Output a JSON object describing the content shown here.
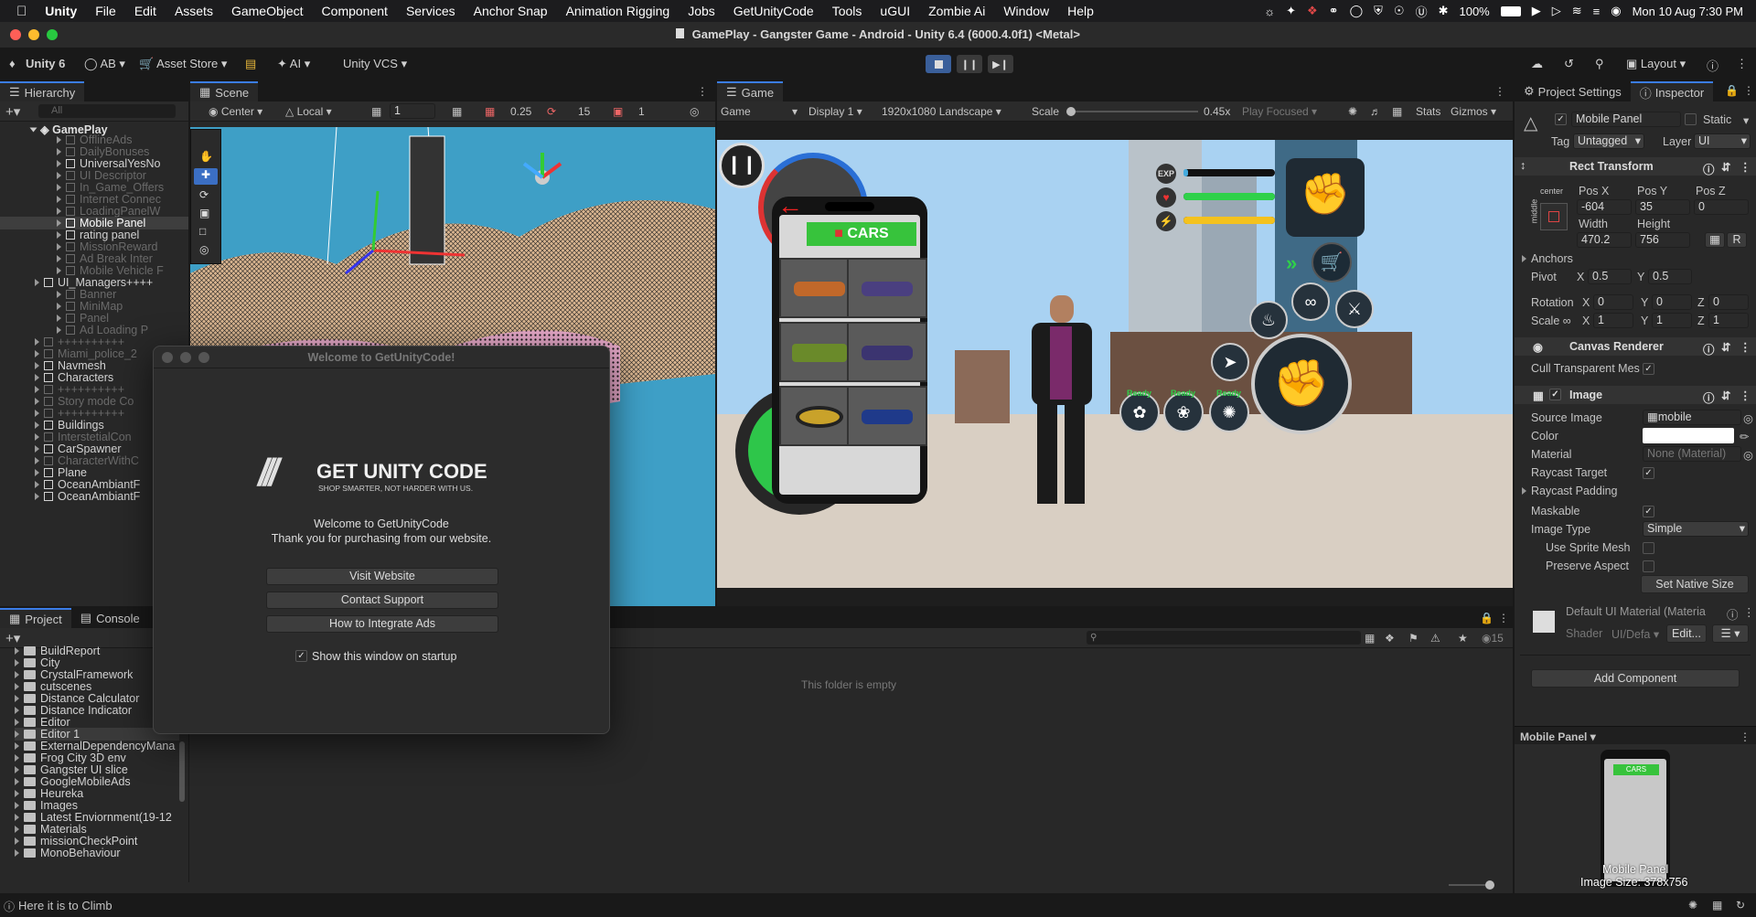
{
  "menubar": {
    "app": "Unity",
    "items": [
      "File",
      "Edit",
      "Assets",
      "GameObject",
      "Component",
      "Services",
      "Anchor Snap",
      "Animation Rigging",
      "Jobs",
      "GetUnityCode",
      "Tools",
      "uGUI",
      "Zombie Ai",
      "Window",
      "Help"
    ],
    "battery": "100%",
    "datetime": "Mon 10 Aug  7:30 PM"
  },
  "window": {
    "title": "GamePlay - Gangster Game - Android - Unity 6.4 (6000.4.0f1) <Metal>"
  },
  "toolbar": {
    "unity_label": "Unity 6",
    "account": "AB",
    "asset_store": "Asset Store",
    "ai": "AI",
    "vcs": "Unity VCS",
    "layout": "Layout"
  },
  "hierarchy": {
    "tab": "Hierarchy",
    "search_placeholder": "All",
    "root": "GamePlay",
    "items": [
      {
        "label": "OfflineAds",
        "dim": true
      },
      {
        "label": "DailyBonuses",
        "dim": true
      },
      {
        "label": "UniversalYesNo",
        "dim": false
      },
      {
        "label": "UI Descriptor",
        "dim": true
      },
      {
        "label": "In_Game_Offers",
        "dim": true
      },
      {
        "label": "Internet Connec",
        "dim": true
      },
      {
        "label": "LoadingPanelW",
        "dim": true
      },
      {
        "label": "Mobile Panel",
        "dim": false,
        "selected": true
      },
      {
        "label": "rating panel",
        "dim": false
      },
      {
        "label": "MissionReward",
        "dim": true
      },
      {
        "label": "Ad Break Inter",
        "dim": true
      },
      {
        "label": "Mobile Vehicle F",
        "dim": true
      },
      {
        "label": "UI_Managers++++",
        "dim": false
      },
      {
        "label": "Banner",
        "dim": true
      },
      {
        "label": "MiniMap",
        "dim": true
      },
      {
        "label": "Panel",
        "dim": true
      },
      {
        "label": "Ad Loading P",
        "dim": true
      },
      {
        "label": "++++++++++",
        "dim": true
      },
      {
        "label": "Miami_police_2",
        "dim": true
      },
      {
        "label": "Navmesh",
        "dim": false
      },
      {
        "label": "Characters",
        "dim": false
      },
      {
        "label": "++++++++++",
        "dim": true
      },
      {
        "label": "Story mode Co",
        "dim": true
      },
      {
        "label": "++++++++++",
        "dim": true
      },
      {
        "label": "Buildings",
        "dim": false
      },
      {
        "label": "InterstetialCon",
        "dim": true
      },
      {
        "label": "CarSpawner",
        "dim": false
      },
      {
        "label": "CharacterWithC",
        "dim": true
      },
      {
        "label": "Plane",
        "dim": false
      },
      {
        "label": "OceanAmbiantF",
        "dim": false
      },
      {
        "label": "OceanAmbiantF",
        "dim": false
      }
    ]
  },
  "scene": {
    "tab": "Scene",
    "pivot": "Center",
    "space": "Local",
    "grid": "1",
    "snap": "0.25",
    "angle": "15",
    "scale": "1"
  },
  "game": {
    "tab": "Game",
    "mode": "Game",
    "display": "Display 1",
    "resolution": "1920x1080 Landscape",
    "scale_label": "Scale",
    "scale_value": "0.45x",
    "play_focused": "Play Focused",
    "stats": "Stats",
    "gizmos": "Gizmos",
    "hud": {
      "exp": "EXP",
      "exp_fill": 0.05,
      "health_fill": 1.0,
      "energy_fill": 1.0,
      "ready": [
        "Ready",
        "Ready",
        "Ready"
      ]
    },
    "phone": {
      "title": "CARS"
    }
  },
  "inspector": {
    "tabs": [
      "Project Settings",
      "Inspector"
    ],
    "object_name": "Mobile Panel",
    "static": "Static",
    "tag_label": "Tag",
    "tag": "Untagged",
    "layer_label": "Layer",
    "layer": "UI",
    "rect_transform": {
      "title": "Rect Transform",
      "anchor_h": "center",
      "anchor_v": "middle",
      "pos_x_label": "Pos X",
      "pos_y_label": "Pos Y",
      "pos_z_label": "Pos Z",
      "pos_x": "-604",
      "pos_y": "35",
      "pos_z": "0",
      "width_label": "Width",
      "height_label": "Height",
      "width": "470.2",
      "height": "756",
      "anchors": "Anchors",
      "pivot_label": "Pivot",
      "pivot_x": "0.5",
      "pivot_y": "0.5",
      "rotation_label": "Rotation",
      "rot_x": "0",
      "rot_y": "0",
      "rot_z": "0",
      "scale_label": "Scale",
      "scale_x": "1",
      "scale_y": "1",
      "scale_z": "1"
    },
    "canvas_renderer": {
      "title": "Canvas Renderer",
      "cull_label": "Cull Transparent Mes"
    },
    "image": {
      "title": "Image",
      "source_image_label": "Source Image",
      "source_image": "mobile",
      "color_label": "Color",
      "material_label": "Material",
      "material": "None (Material)",
      "raycast_target": "Raycast Target",
      "raycast_padding": "Raycast Padding",
      "maskable": "Maskable",
      "image_type_label": "Image Type",
      "image_type": "Simple",
      "use_sprite_mesh": "Use Sprite Mesh",
      "preserve_aspect": "Preserve Aspect",
      "set_native_size": "Set Native Size"
    },
    "material": {
      "name": "Default UI Material (Materia",
      "shader_label": "Shader",
      "shader": "UI/Defa",
      "edit": "Edit..."
    },
    "add_component": "Add Component",
    "preview": {
      "title": "Mobile Panel",
      "caption1": "Mobile Panel",
      "caption2": "Image Size: 378x756",
      "phone_text": "CARS"
    }
  },
  "project": {
    "tabs": [
      "Project",
      "Console"
    ],
    "items": [
      "BuildReport",
      "City",
      "CrystalFramework",
      "cutscenes",
      "Distance Calculator",
      "Distance Indicator",
      "Editor",
      "Editor 1",
      "ExternalDependencyMana",
      "Frog City 3D env",
      "Gangster UI slice",
      "GoogleMobileAds",
      "Heureka",
      "Images",
      "Latest Enviornment(19-12",
      "Materials",
      "missionCheckPoint",
      "MonoBehaviour"
    ],
    "empty_text": "This folder is empty",
    "count": "15"
  },
  "dialog": {
    "title": "Welcome to GetUnityCode!",
    "logo_text": "GET UNITY CODE",
    "logo_sub": "SHOP SMARTER, NOT HARDER WITH US.",
    "heading": "Welcome to GetUnityCode",
    "message": "Thank you for purchasing from our website.",
    "buttons": [
      "Visit Website",
      "Contact Support",
      "How to Integrate Ads"
    ],
    "checkbox_label": "Show this window on startup"
  },
  "statusbar": {
    "text": "Here it is to Climb"
  }
}
